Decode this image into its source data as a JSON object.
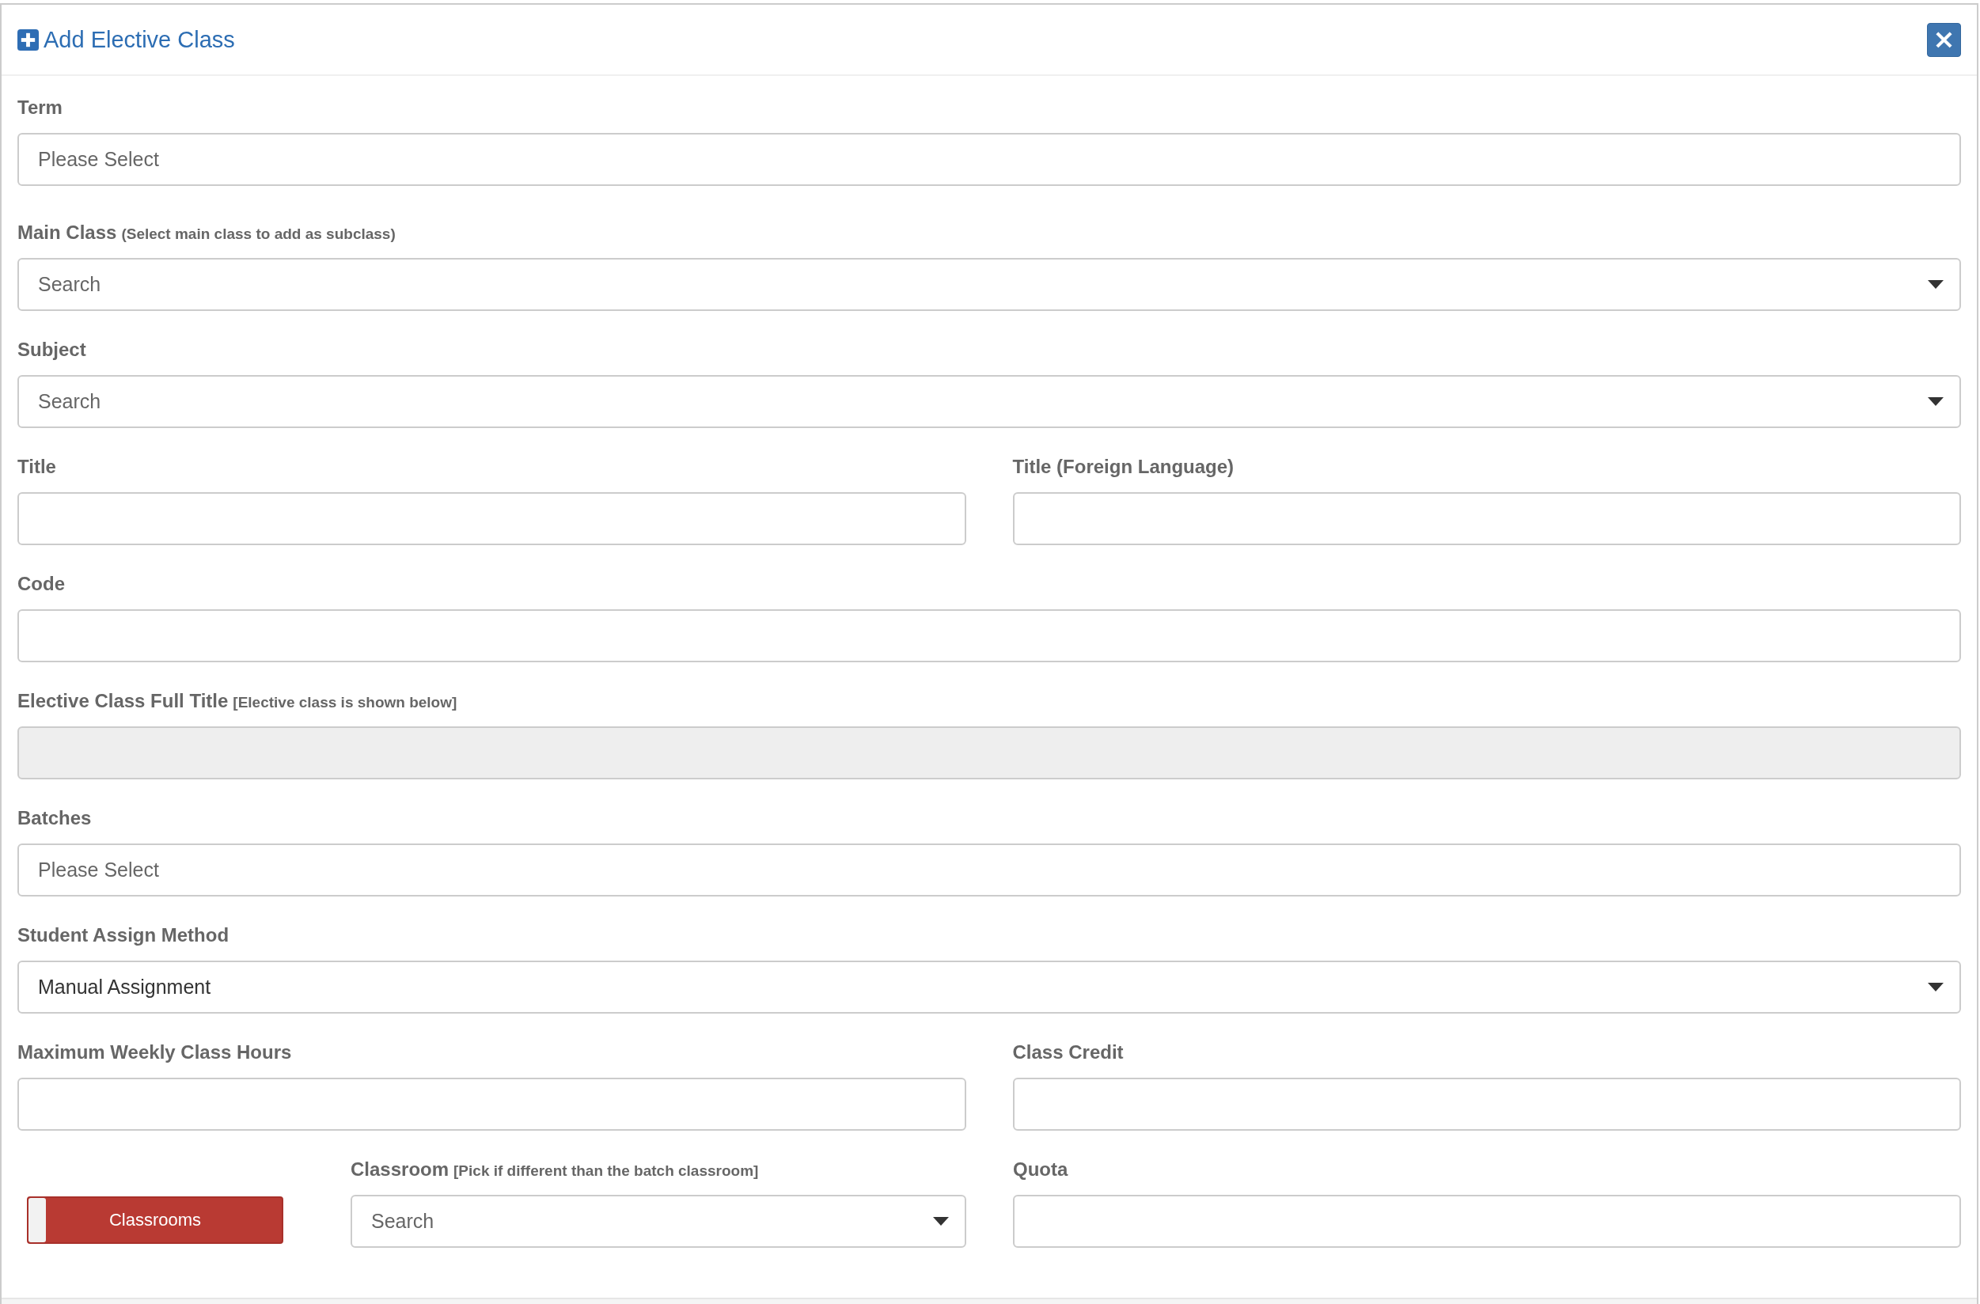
{
  "dialog": {
    "title": "Add Elective Class",
    "close_label": "×"
  },
  "rows": [
    {
      "fields": [
        {
          "kind": "select",
          "label": "Term",
          "placeholder": "Please Select"
        }
      ]
    },
    {
      "fields": [
        {
          "kind": "dropdown",
          "label": "Main Class",
          "note": "(Select main class to add as subclass)",
          "placeholder": "Search"
        }
      ]
    },
    {
      "fields": [
        {
          "kind": "dropdown",
          "label": "Subject",
          "placeholder": "Search"
        }
      ]
    },
    {
      "fields": [
        {
          "kind": "text",
          "label": "Title"
        },
        {
          "kind": "text",
          "label": "Title (Foreign Language)"
        }
      ]
    },
    {
      "fields": [
        {
          "kind": "text",
          "label": "Code"
        }
      ]
    },
    {
      "fields": [
        {
          "kind": "readonly",
          "label": "Elective Class Full Title",
          "note": "[Elective class is shown below]"
        }
      ]
    },
    {
      "fields": [
        {
          "kind": "select",
          "label": "Batches",
          "placeholder": "Please Select"
        }
      ]
    },
    {
      "fields": [
        {
          "kind": "dropdown",
          "label": "Student Assign Method",
          "value": "Manual Assignment"
        }
      ]
    },
    {
      "fields": [
        {
          "kind": "text",
          "label": "Maximum Weekly Class Hours"
        },
        {
          "kind": "text",
          "label": "Class Credit"
        }
      ]
    },
    {
      "fields": [
        {
          "kind": "toggle",
          "label": "Classrooms",
          "on": false
        },
        {
          "kind": "dropdown",
          "label": "Classroom",
          "note": "[Pick if different than the batch classroom]",
          "placeholder": "Search"
        },
        {
          "kind": "text",
          "label": "Quota"
        }
      ]
    }
  ]
}
